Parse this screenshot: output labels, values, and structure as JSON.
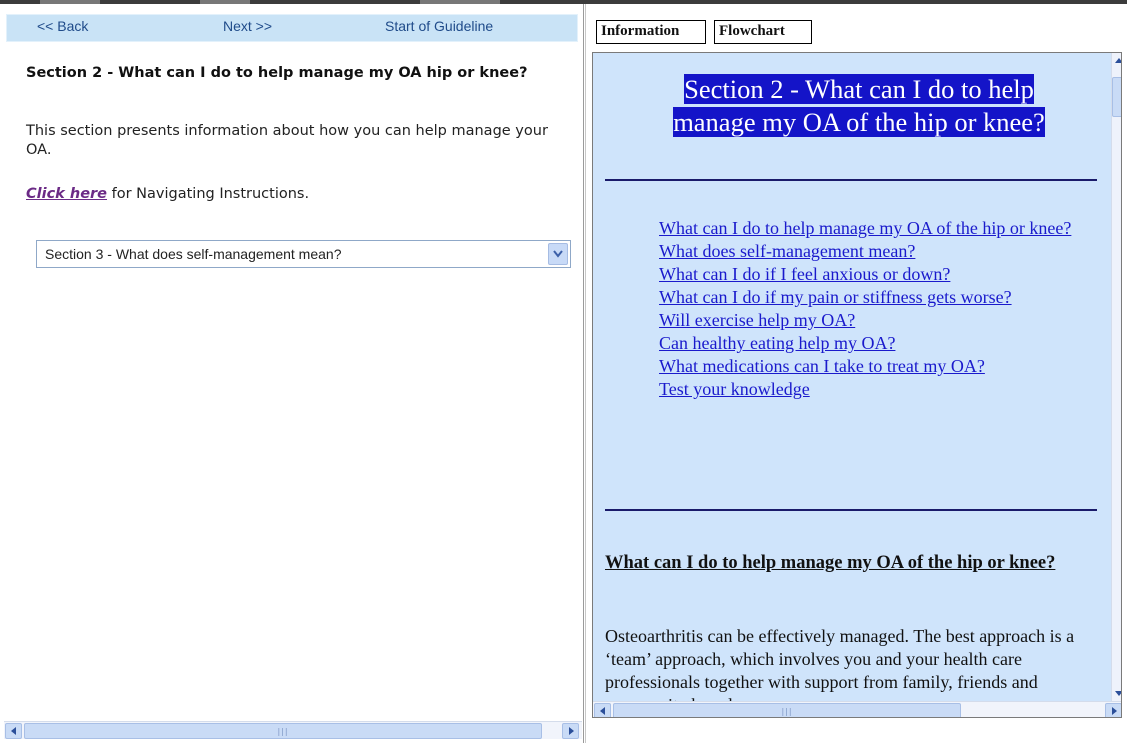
{
  "nav": {
    "back": "<< Back",
    "next": "Next >>",
    "start": "Start of Guideline"
  },
  "left": {
    "section_title": "Section 2 - What can I do to help manage my OA hip or knee?",
    "description": "This section presents information about how you can help manage your OA.",
    "click_here": "Click here",
    "instructions_suffix": " for Navigating Instructions.",
    "section_select": {
      "selected": "Section 3 - What does self-management mean?"
    }
  },
  "tabs": [
    {
      "label": "Information",
      "active": true
    },
    {
      "label": "Flowchart",
      "active": false
    }
  ],
  "content": {
    "title": "Section 2 - What can I do to help manage my OA of the hip or knee?",
    "links": [
      "What can I do to help manage my OA of the hip or knee?",
      "What does self-management mean?",
      "What can I do if I feel anxious or down?",
      "What can I do if my pain or stiffness gets worse?",
      "Will exercise help my OA?",
      "Can healthy eating help my OA?",
      "What medications can I take to treat my OA?",
      "Test your knowledge"
    ],
    "subheading": "What can I do to help manage my OA of the hip or knee?",
    "paragraph": "Osteoarthritis can be effectively managed. The best approach is a ‘team’ approach, which involves you and your health care professionals together with support from family, friends and community based"
  },
  "colors": {
    "nav_bar": "#c9e3f6",
    "content_bg": "#cfe4fb",
    "title_highlight": "#1414c8",
    "link": "#1a1acc",
    "click_here": "#6b2a86"
  },
  "icons": {
    "select_arrow": "chevron-down-icon",
    "scroll_left": "arrow-left-icon",
    "scroll_right": "arrow-right-icon",
    "scroll_up": "arrow-up-icon",
    "scroll_down": "arrow-down-icon"
  }
}
